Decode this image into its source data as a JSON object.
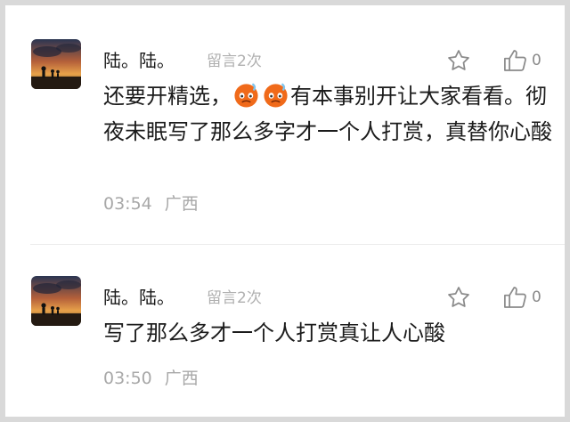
{
  "comments": [
    {
      "username": "陆。陆。",
      "reply_count": "留言2次",
      "like_count": "0",
      "text_before": "还要开精选，",
      "emojis": [
        "hot-face-emoji",
        "hot-face-emoji"
      ],
      "text_after": "有本事别开让大家看看。彻夜未眠写了那么多字才一个人打赏，真替你心酸",
      "time": "03:54",
      "location": "广西"
    },
    {
      "username": "陆。陆。",
      "reply_count": "留言2次",
      "like_count": "0",
      "text": "写了那么多才一个人打赏真让人心酸",
      "time": "03:50",
      "location": "广西"
    }
  ],
  "colors": {
    "background": "#ffffff",
    "frame": "#d9d9d9",
    "meta_text": "#a8a8a8",
    "body_text": "#1b1b1b",
    "emoji_orange": "#f06a1a"
  }
}
